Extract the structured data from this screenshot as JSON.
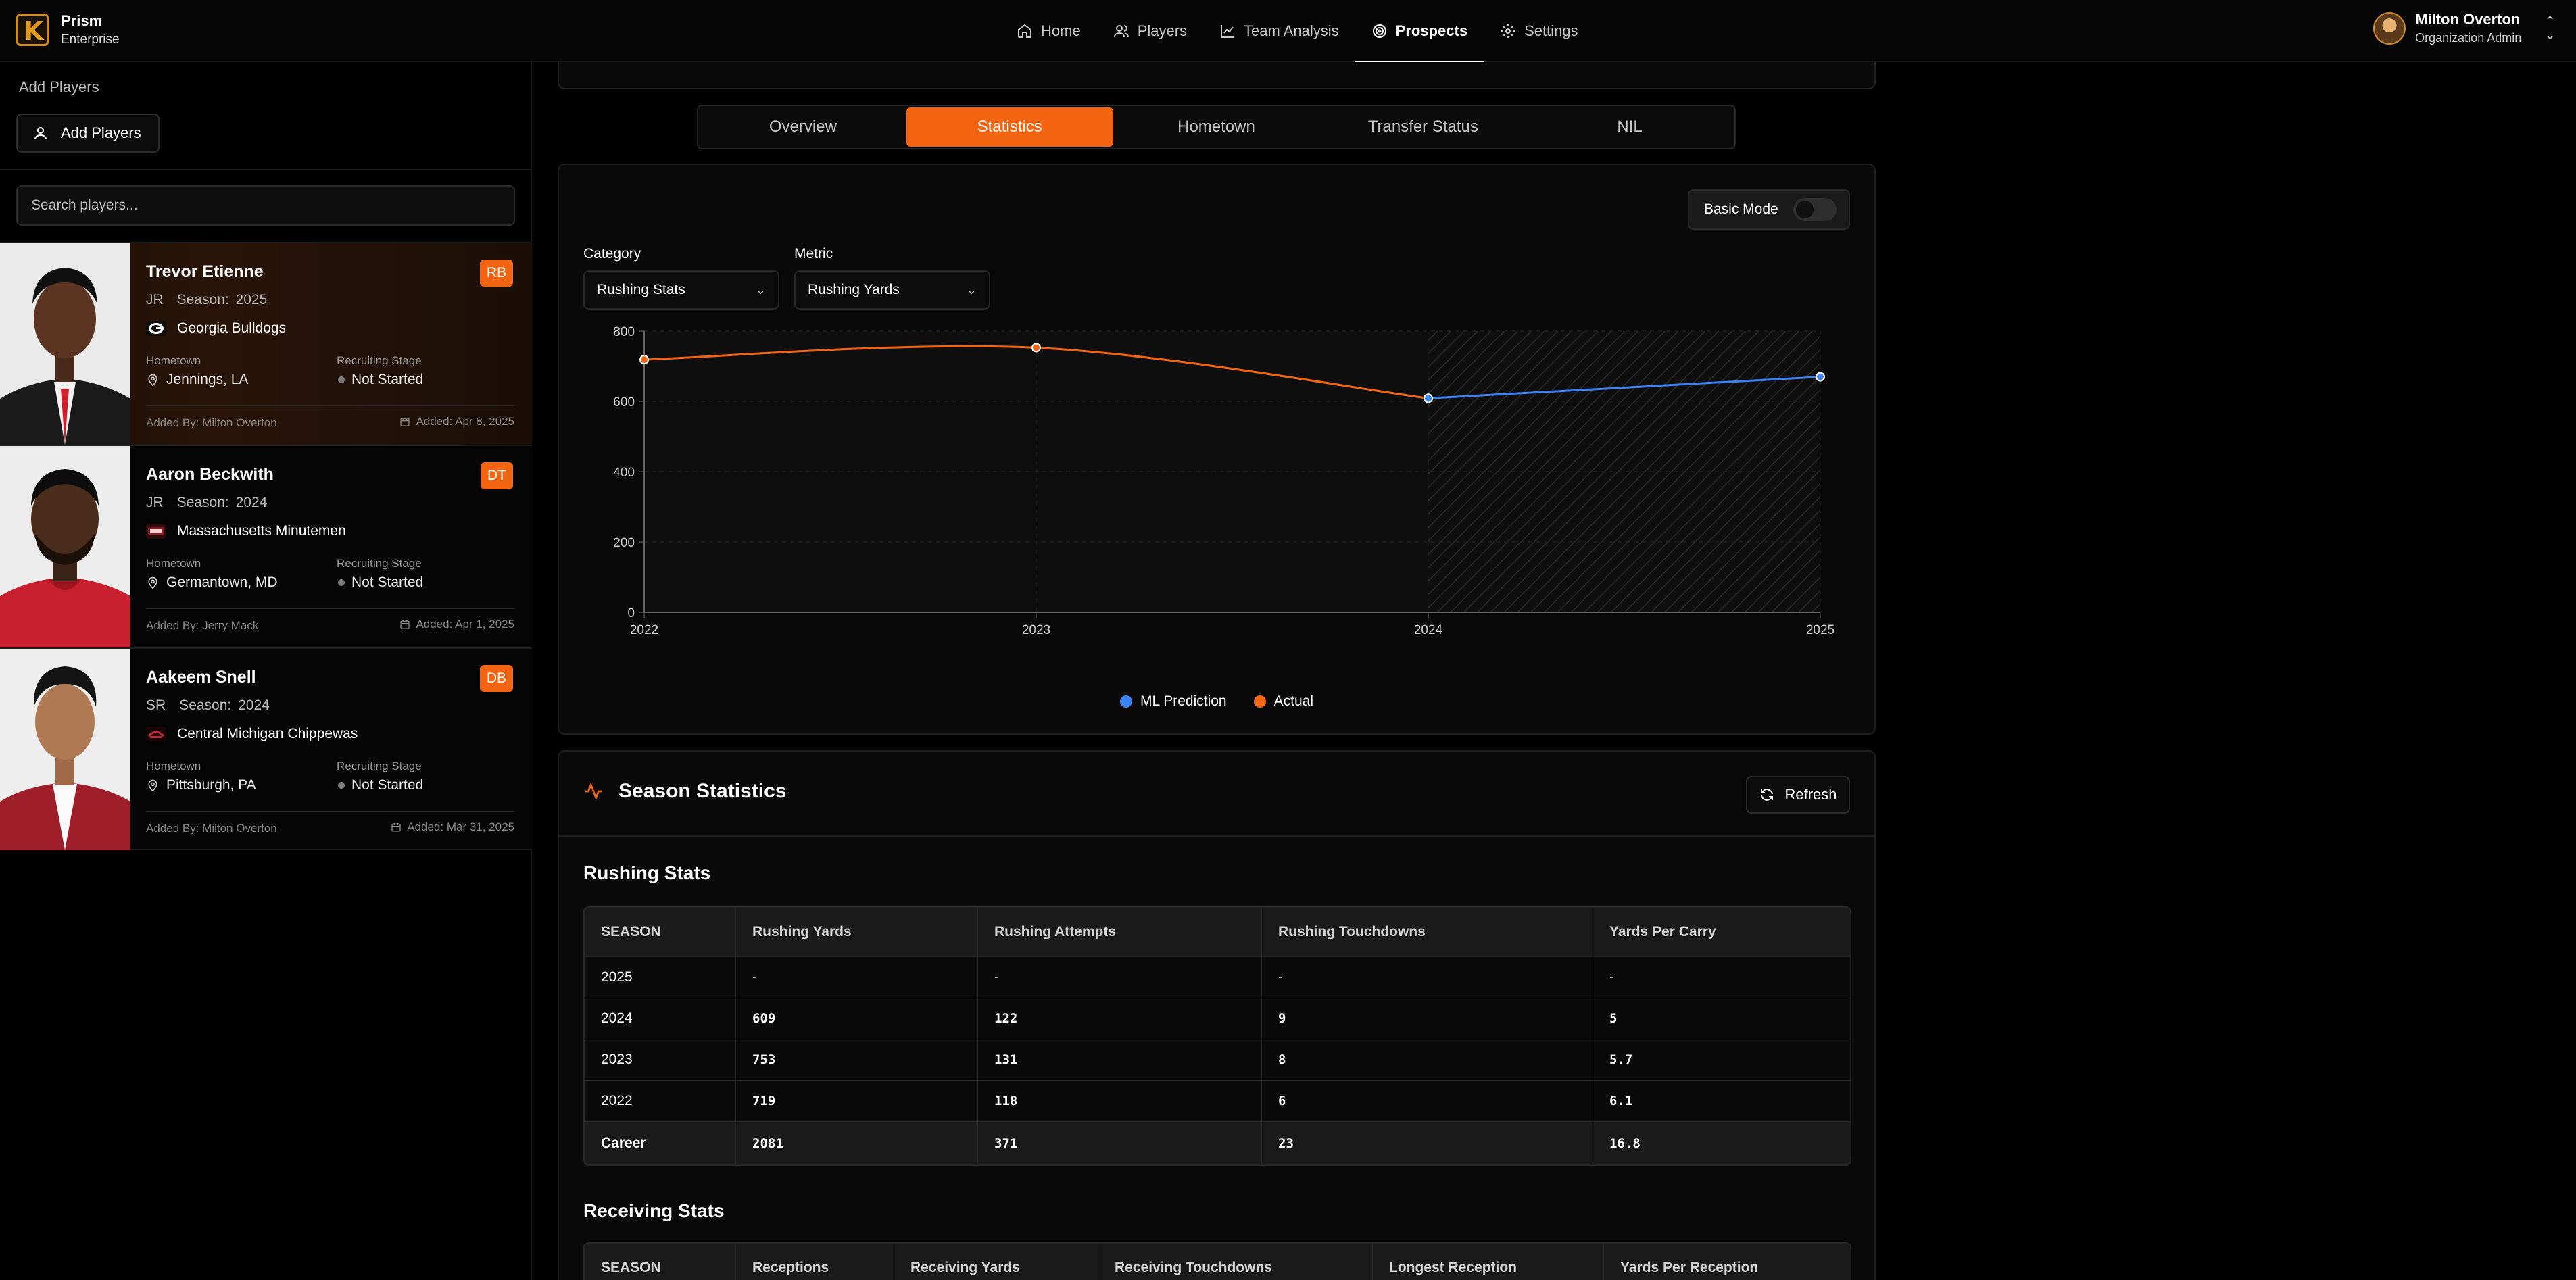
{
  "brand": {
    "name": "Prism",
    "tier": "Enterprise"
  },
  "nav": [
    {
      "label": "Home",
      "icon": "home-icon"
    },
    {
      "label": "Players",
      "icon": "users-icon"
    },
    {
      "label": "Team Analysis",
      "icon": "chart-line-icon"
    },
    {
      "label": "Prospects",
      "icon": "target-icon",
      "active": true
    },
    {
      "label": "Settings",
      "icon": "gear-icon"
    }
  ],
  "user": {
    "name": "Milton Overton",
    "role": "Organization Admin"
  },
  "sidebar": {
    "title": "Add Players",
    "add_button": "Add Players",
    "search_placeholder": "Search players...",
    "hometown_label": "Hometown",
    "stage_label": "Recruiting Stage",
    "players": [
      {
        "name": "Trevor Etienne",
        "year": "JR",
        "season": "Season: 2025",
        "position": "RB",
        "school": "Georgia Bulldogs",
        "hometown": "Jennings, LA",
        "stage": "Not Started",
        "added_by": "Added By: Milton Overton",
        "added_on": "Added: Apr 8, 2025",
        "selected": true
      },
      {
        "name": "Aaron Beckwith",
        "year": "JR",
        "season": "Season: 2024",
        "position": "DT",
        "school": "Massachusetts Minutemen",
        "hometown": "Germantown, MD",
        "stage": "Not Started",
        "added_by": "Added By: Jerry Mack",
        "added_on": "Added: Apr 1, 2025"
      },
      {
        "name": "Aakeem Snell",
        "year": "SR",
        "season": "Season: 2024",
        "position": "DB",
        "school": "Central Michigan Chippewas",
        "hometown": "Pittsburgh, PA",
        "stage": "Not Started",
        "added_by": "Added By: Milton Overton",
        "added_on": "Added: Mar 31, 2025"
      }
    ]
  },
  "tabs": [
    "Overview",
    "Statistics",
    "Hometown",
    "Transfer Status",
    "NIL"
  ],
  "active_tab": "Statistics",
  "controls": {
    "basic_mode": "Basic Mode",
    "category_label": "Category",
    "category_value": "Rushing Stats",
    "metric_label": "Metric",
    "metric_value": "Rushing Yards"
  },
  "chart_data": {
    "type": "line",
    "x": [
      "2022",
      "2023",
      "2024",
      "2025"
    ],
    "ylim": [
      0,
      800
    ],
    "yticks": [
      "0",
      "200",
      "400",
      "600",
      "800"
    ],
    "grid": true,
    "legend_position": "bottom",
    "prediction_region_start": "2024",
    "series": [
      {
        "name": "Actual",
        "color": "#f26411",
        "x": [
          "2022",
          "2023",
          "2024"
        ],
        "values": [
          719,
          753,
          609
        ]
      },
      {
        "name": "ML Prediction",
        "color": "#3b82f6",
        "x": [
          "2024",
          "2025"
        ],
        "values": [
          609,
          670
        ]
      }
    ]
  },
  "season_stats": {
    "title": "Season Statistics",
    "refresh": "Refresh",
    "rushing": {
      "title": "Rushing Stats",
      "columns": [
        "SEASON",
        "Rushing Yards",
        "Rushing Attempts",
        "Rushing Touchdowns",
        "Yards Per Carry"
      ],
      "rows": [
        [
          "2025",
          "-",
          "-",
          "-",
          "-"
        ],
        [
          "2024",
          "609",
          "122",
          "9",
          "5"
        ],
        [
          "2023",
          "753",
          "131",
          "8",
          "5.7"
        ],
        [
          "2022",
          "719",
          "118",
          "6",
          "6.1"
        ]
      ],
      "career": [
        "Career",
        "2081",
        "371",
        "23",
        "16.8"
      ]
    },
    "receiving": {
      "title": "Receiving Stats",
      "columns": [
        "SEASON",
        "Receptions",
        "Receiving Yards",
        "Receiving Touchdowns",
        "Longest Reception",
        "Yards Per Reception"
      ]
    }
  }
}
